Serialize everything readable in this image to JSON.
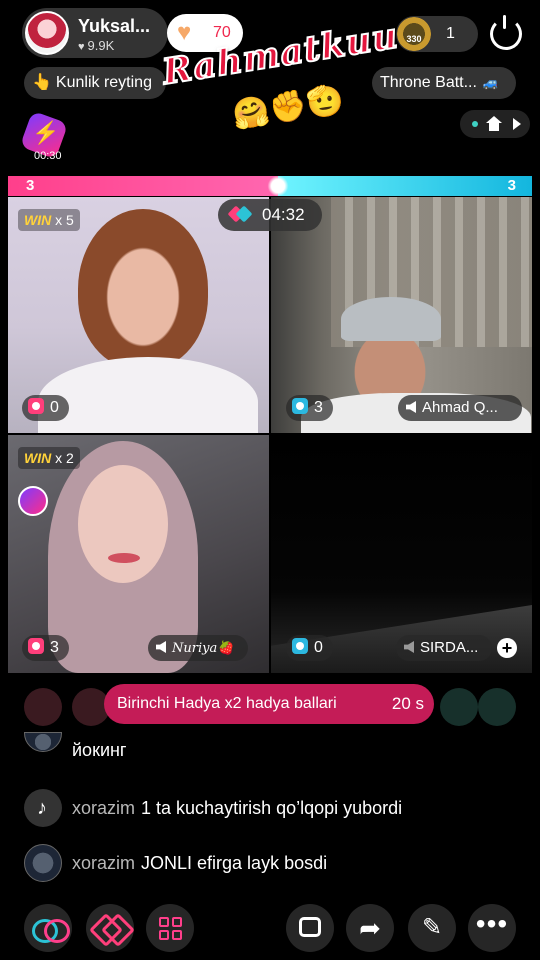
{
  "header": {
    "host_name": "Yuksal...",
    "host_likes": "9.9K",
    "fav_count": "70",
    "viewer_badge": "330",
    "viewer_count": "1"
  },
  "pills": {
    "rating": "Kunlik reyting",
    "throne": "Throne Batt..."
  },
  "sticker": {
    "text": "Rahmatkuu",
    "emoji": "🤗✊🫡"
  },
  "promo": {
    "timer": "00:30"
  },
  "battle": {
    "score_left": "3",
    "score_right": "3",
    "timer": "04:32"
  },
  "tiles": [
    {
      "win_label": "WIN",
      "win_mult": "x 5",
      "gifts": "0"
    },
    {
      "gifts": "3",
      "name": "Ahmad Q..."
    },
    {
      "win_label": "WIN",
      "win_mult": "x 2",
      "gifts": "3",
      "name": "Nuriya🍓"
    },
    {
      "gifts": "0",
      "name": "SIRDA..."
    }
  ],
  "gift_banner": {
    "text": "Birinchi Hadya x2 hadya ballari",
    "seconds": "20 s"
  },
  "chat": [
    {
      "user": "",
      "text": "йокинг"
    },
    {
      "user": "xorazim",
      "text": "1 ta kuchaytirish qo’lqopi yubordi"
    },
    {
      "user": "xorazim",
      "text": "JONLI efirga layk bosdi"
    }
  ],
  "icons": {
    "tool_1": "link-icon",
    "tool_2": "battle-icon",
    "tool_3": "apps-icon",
    "tool_4": "chatbox-icon",
    "tool_5": "share-icon",
    "tool_6": "magic-wand-icon",
    "tool_7": "more-icon"
  },
  "colors": {
    "accent_pink": "#ff3f8b",
    "accent_cyan": "#2cc3d6",
    "banner": "#c41c57",
    "gold": "#ffd23a"
  }
}
